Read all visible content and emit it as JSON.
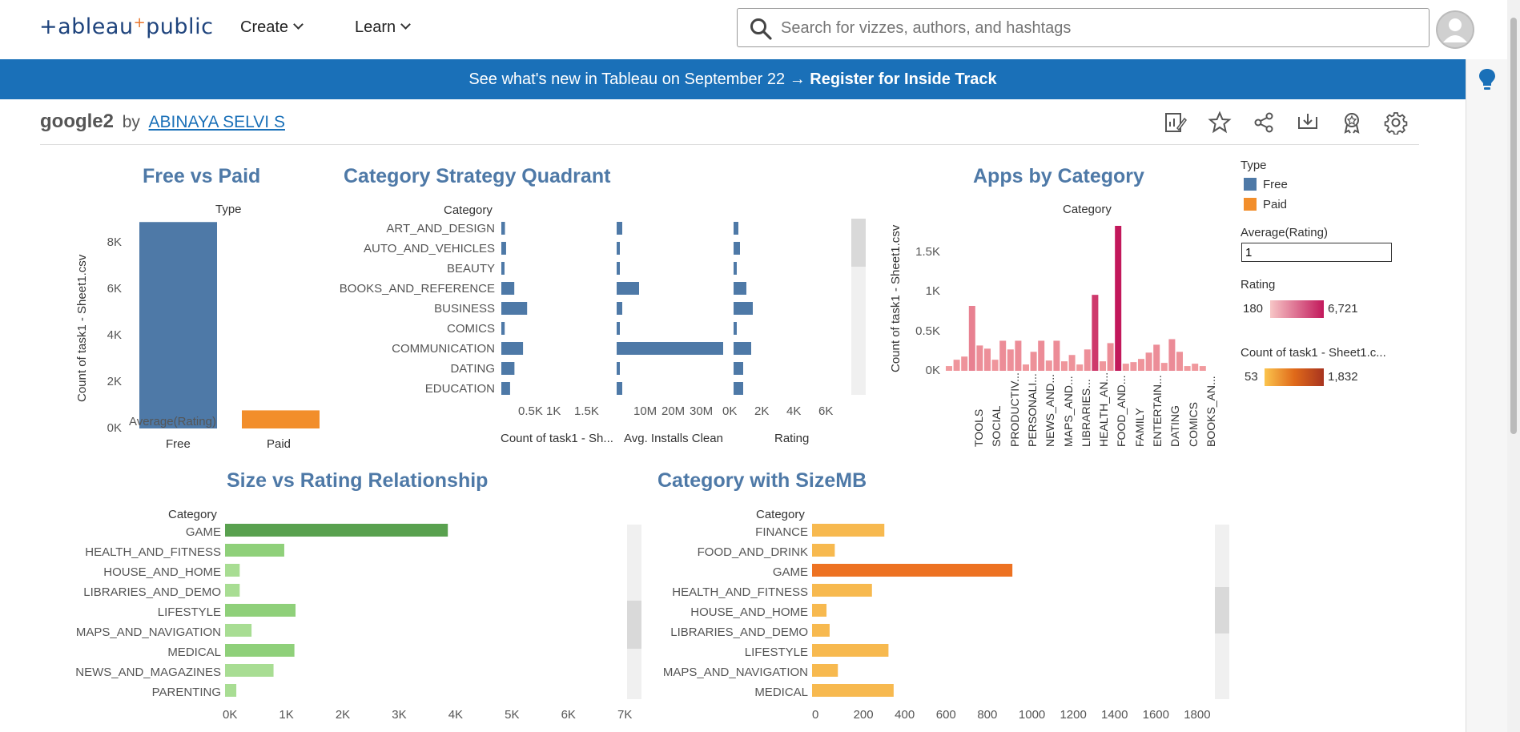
{
  "header": {
    "logo_prefix": "+ableau",
    "logo_plus": "+",
    "logo_suffix": "public",
    "menus": [
      "Create",
      "Learn"
    ],
    "search_placeholder": "Search for vizzes, authors, and hashtags"
  },
  "banner": {
    "text": "See what's new in Tableau on September 22 → ",
    "link": "Register for Inside Track"
  },
  "viz": {
    "title": "google2",
    "by": "by",
    "author": "ABINAYA SELVI S"
  },
  "colors": {
    "blue": "#4e79a7",
    "orange": "#f28e2b",
    "banner": "#1a70b8",
    "green_dark": "#59a14f",
    "green_light": "#a8dd93",
    "red_dark": "#c2185b",
    "red_light": "#f4a3a3",
    "orange_light": "#f7b94f",
    "orange_dark": "#ed7222"
  },
  "legends": {
    "type_title": "Type",
    "type_items": [
      "Free",
      "Paid"
    ],
    "avg_rating_title": "Average(Rating)",
    "avg_rating_value": "1",
    "rating_title": "Rating",
    "rating_min": "180",
    "rating_max": "6,721",
    "count_title": "Count of task1 - Sheet1.c...",
    "count_min": "53",
    "count_max": "1,832"
  },
  "chart_data": [
    {
      "type": "bar",
      "title": "Free vs Paid",
      "header": "Type",
      "ylabel": "Count of task1 - Sheet1.csv",
      "categories": [
        "Free",
        "Paid"
      ],
      "values": [
        8900,
        780
      ],
      "ylim": [
        0,
        9000
      ],
      "yticks": [
        "0K",
        "2K",
        "4K",
        "6K",
        "8K"
      ],
      "yticks_values": [
        0,
        2000,
        4000,
        6000,
        8000
      ],
      "overlay_label": "Average(Rating)"
    },
    {
      "type": "bar",
      "title": "Category Strategy Quadrant",
      "header": "Category",
      "categories": [
        "ART_AND_DESIGN",
        "AUTO_AND_VEHICLES",
        "BEAUTY",
        "BOOKS_AND_REFERENCE",
        "BUSINESS",
        "COMICS",
        "COMMUNICATION",
        "DATING",
        "EDUCATION"
      ],
      "series": [
        {
          "name": "Count of task1 - Sh...",
          "values": [
            65,
            85,
            53,
            231,
            460,
            60,
            387,
            234,
            156
          ],
          "xlim": [
            0,
            2000
          ],
          "ticks": [
            "0.5K",
            "1K",
            "1.5K"
          ],
          "tick_values": [
            500,
            1000,
            1500
          ]
        },
        {
          "name": "Avg. Installs Clean",
          "values": [
            2000000,
            600000,
            500000,
            8000000,
            2000000,
            900000,
            38000000,
            1100000,
            2000000
          ],
          "xlim": [
            0,
            40000000
          ],
          "ticks": [
            "10M",
            "20M",
            "30M"
          ],
          "tick_values": [
            10000000,
            20000000,
            30000000
          ]
        },
        {
          "name": "Rating",
          "values": [
            300,
            400,
            200,
            800,
            1200,
            200,
            1100,
            600,
            600
          ],
          "xlim": [
            0,
            7000
          ],
          "ticks": [
            "0K",
            "2K",
            "4K",
            "6K"
          ],
          "tick_values": [
            0,
            2000,
            4000,
            6000
          ]
        }
      ]
    },
    {
      "type": "bar",
      "title": "Apps by Category",
      "header": "Category",
      "ylabel": "Count of task1 - Sheet1.csv",
      "ylim": [
        -100,
        1850
      ],
      "yticks": [
        "0K",
        "0.5K",
        "1K",
        "1.5K"
      ],
      "yticks_values": [
        0,
        500,
        1000,
        1500
      ],
      "labels": [
        "TOOLS",
        "SOCIAL",
        "PRODUCTIV...",
        "PERSONALI...",
        "NEWS_AND...",
        "MAPS_AND...",
        "LIBRARIES...",
        "HEALTH_AN...",
        "FOOD_AND...",
        "FAMILY",
        "ENTERTAIN...",
        "DATING",
        "COMICS",
        "BOOKS_AN..."
      ],
      "values": [
        60,
        140,
        180,
        820,
        320,
        280,
        140,
        380,
        270,
        380,
        80,
        240,
        380,
        130,
        380,
        120,
        200,
        80,
        270,
        960,
        120,
        350,
        1832,
        90,
        110,
        150,
        230,
        330,
        100,
        400,
        240,
        60,
        90,
        60
      ]
    },
    {
      "type": "bar",
      "title": "Size vs Rating Relationship",
      "header": "Category",
      "categories": [
        "GAME",
        "HEALTH_AND_FITNESS",
        "HOUSE_AND_HOME",
        "LIBRARIES_AND_DEMO",
        "LIFESTYLE",
        "MAPS_AND_NAVIGATION",
        "MEDICAL",
        "NEWS_AND_MAGAZINES",
        "PARENTING"
      ],
      "values": [
        3950,
        1050,
        260,
        260,
        1250,
        470,
        1230,
        860,
        200
      ],
      "xlim": [
        0,
        7000
      ],
      "xticks": [
        "0K",
        "1K",
        "2K",
        "3K",
        "4K",
        "5K",
        "6K",
        "7K"
      ],
      "xticks_values": [
        0,
        1000,
        2000,
        3000,
        4000,
        5000,
        6000,
        7000
      ]
    },
    {
      "type": "bar",
      "title": "Category with SizeMB",
      "header": "Category",
      "categories": [
        "FINANCE",
        "FOOD_AND_DRINK",
        "GAME",
        "HEALTH_AND_FITNESS",
        "HOUSE_AND_HOME",
        "LIBRARIES_AND_DEMO",
        "LIFESTYLE",
        "MAPS_AND_NAVIGATION",
        "MEDICAL"
      ],
      "values": [
        350,
        110,
        970,
        290,
        70,
        85,
        370,
        125,
        395
      ],
      "xlim": [
        0,
        1900
      ],
      "xticks": [
        "0",
        "200",
        "400",
        "600",
        "800",
        "1000",
        "1200",
        "1400",
        "1600",
        "1800"
      ],
      "xticks_values": [
        0,
        200,
        400,
        600,
        800,
        1000,
        1200,
        1400,
        1600,
        1800
      ]
    }
  ]
}
